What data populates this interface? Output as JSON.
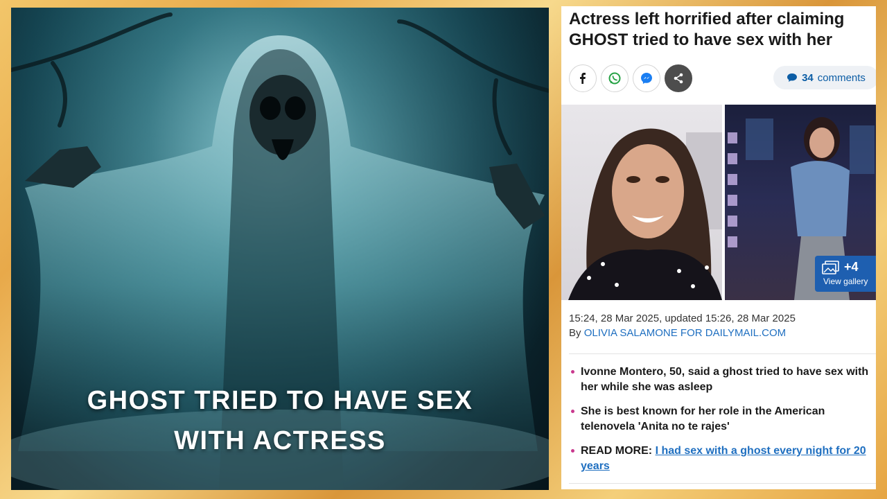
{
  "video_caption": {
    "line1": "GHOST TRIED TO HAVE SEX",
    "line2": "WITH ACTRESS"
  },
  "article": {
    "headline": "Actress left horrified after claiming GHOST tried to have sex with her",
    "share_icons": [
      "facebook-icon",
      "whatsapp-icon",
      "messenger-icon",
      "share-icon"
    ],
    "comments": {
      "count": "34",
      "label": "comments"
    },
    "gallery": {
      "count": "+4",
      "label": "View gallery"
    },
    "timestamp": "15:24, 28 Mar 2025, updated 15:26, 28 Mar 2025",
    "byline_prefix": "By",
    "author": "OLIVIA SALAMONE FOR DAILYMAIL.COM",
    "bullets": [
      "Ivonne Montero, 50, said a ghost tried to have sex with her while she was asleep",
      "She is best known for her role in the American telenovela 'Anita no te rajes'"
    ],
    "read_more": {
      "label": "READ MORE:",
      "link_text": "I had sex with a ghost every night for 20 years"
    }
  },
  "colors": {
    "frame_gold": "#e8a94a",
    "link_blue": "#1f6fc0",
    "bullet_pink": "#c9398e",
    "gallery_blue": "#1e5fb0",
    "ghost_teal": "#2f7886"
  }
}
